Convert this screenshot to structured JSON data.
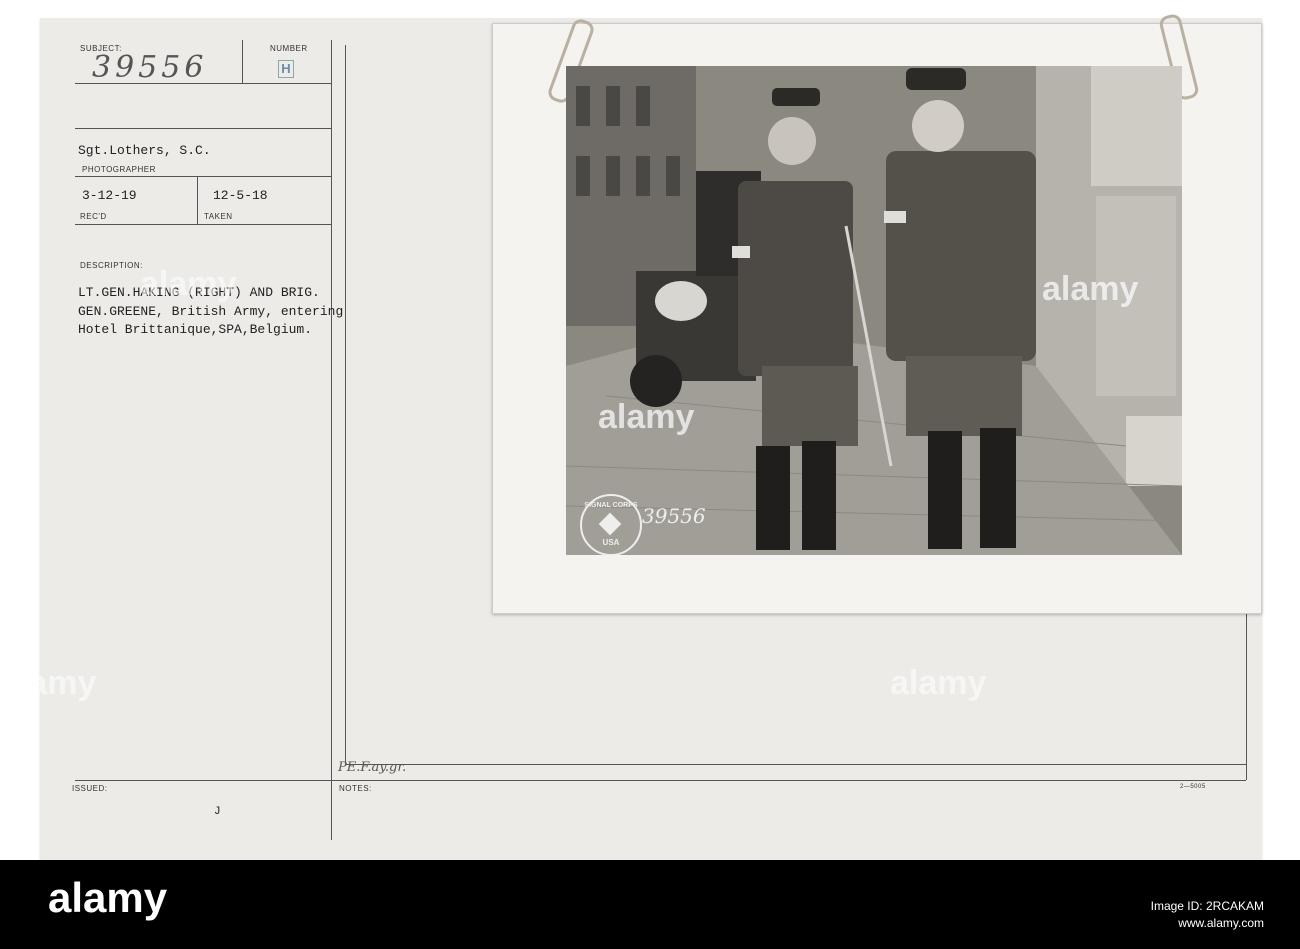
{
  "card": {
    "subject_label": "SUBJECT:",
    "subject_value": "39556",
    "number_label": "NUMBER",
    "number_value": "H",
    "photographer_value": "Sgt.Lothers, S.C.",
    "photographer_label": "PHOTOGRAPHER",
    "recd_value": "3-12-19",
    "recd_label": "REC'D",
    "taken_value": "12-5-18",
    "taken_label": "TAKEN",
    "description_label": "DESCRIPTION:",
    "description_line1": "LT.GEN.HAKING (RIGHT) AND BRIG.",
    "description_line2": "GEN.GREENE, British Army, entering",
    "description_line3": "Hotel Brittanique,SPA,Belgium.",
    "issued_label": "ISSUED:",
    "issued_value": "J",
    "notes_label": "NOTES:",
    "notes_value": "PE.F.ay.gr.",
    "form_number": "2—5005"
  },
  "photo": {
    "stamp_top": "SIGNAL CORPS",
    "stamp_bottom": "USA",
    "stamp_number": "39556"
  },
  "watermark": {
    "text": "alamy"
  },
  "footer": {
    "logo": "alamy",
    "image_id_label": "Image ID: 2RCAKAM",
    "url": "www.alamy.com"
  }
}
